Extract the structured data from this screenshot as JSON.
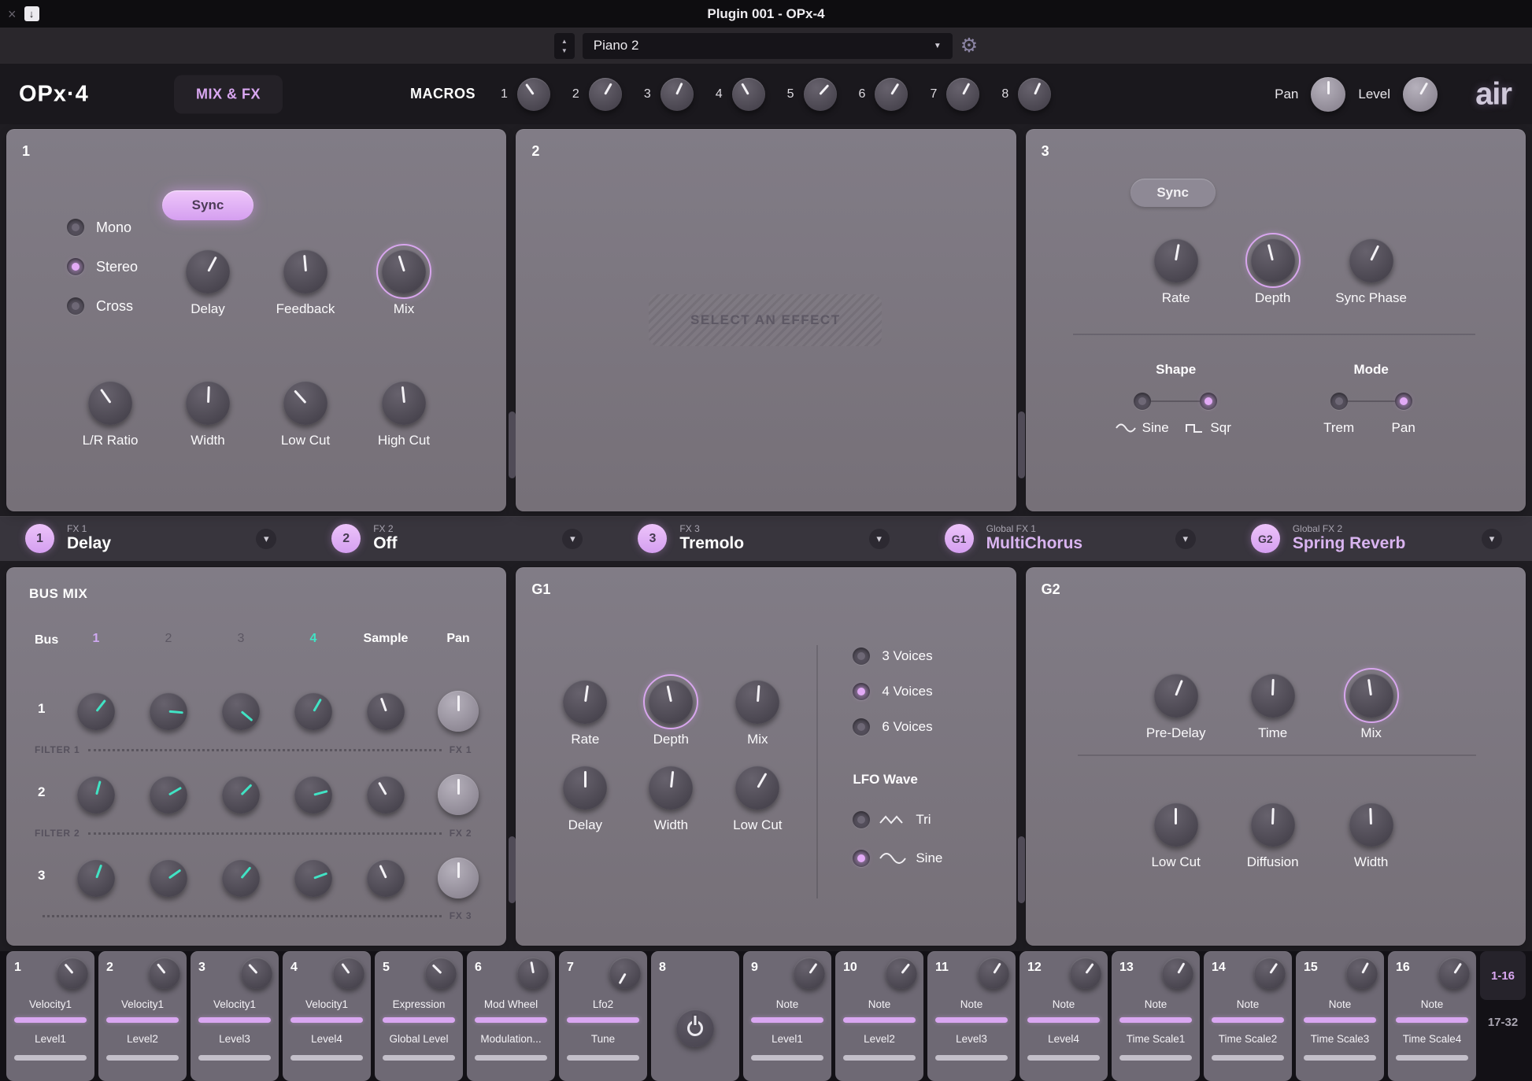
{
  "colors": {
    "accent_purple": "#d9a7f1",
    "accent_teal": "#41e3c4"
  },
  "icons": {
    "close": "×",
    "download": "↓",
    "stepper_up": "▲",
    "stepper_down": "▼",
    "caret_down": "▼",
    "gear": "⚙",
    "chevron_down": "▾"
  },
  "titlebar": {
    "title": "Plugin 001 - OPx-4"
  },
  "presetbar": {
    "preset": "Piano 2"
  },
  "header": {
    "logo": "OPx·4",
    "mixfx_tab": "MIX & FX",
    "macros_label": "MACROS",
    "macro_knobs": [
      "1",
      "2",
      "3",
      "4",
      "5",
      "6",
      "7",
      "8"
    ],
    "pan_label": "Pan",
    "level_label": "Level",
    "brand": "air"
  },
  "fx1": {
    "number": "1",
    "sync_label": "Sync",
    "channel_modes": [
      "Mono",
      "Stereo",
      "Cross"
    ],
    "selected_mode": "Stereo",
    "knobs_top": [
      "Delay",
      "Feedback",
      "Mix"
    ],
    "knobs_bottom": [
      "L/R Ratio",
      "Width",
      "Low Cut",
      "High Cut"
    ]
  },
  "fx2": {
    "number": "2",
    "placeholder": "SELECT AN EFFECT"
  },
  "fx3": {
    "number": "3",
    "sync_label": "Sync",
    "knobs": [
      "Rate",
      "Depth",
      "Sync Phase"
    ],
    "shape": {
      "label": "Shape",
      "options": [
        "Sine",
        "Sqr"
      ],
      "selected": "Sqr"
    },
    "mode": {
      "label": "Mode",
      "options": [
        "Trem",
        "Pan"
      ],
      "selected": "Pan"
    }
  },
  "fx_tabs": [
    {
      "id": "1",
      "sub": "FX 1",
      "name": "Delay"
    },
    {
      "id": "2",
      "sub": "FX 2",
      "name": "Off"
    },
    {
      "id": "3",
      "sub": "FX 3",
      "name": "Tremolo"
    },
    {
      "id": "G1",
      "sub": "Global FX 1",
      "name": "MultiChorus"
    },
    {
      "id": "G2",
      "sub": "Global FX 2",
      "name": "Spring Reverb"
    }
  ],
  "bus_mix": {
    "title": "BUS MIX",
    "bus_label": "Bus",
    "columns": [
      "1",
      "2",
      "3",
      "4",
      "Sample",
      "Pan"
    ],
    "rows": [
      {
        "num": "1",
        "left": "FILTER 1",
        "right": "FX 1"
      },
      {
        "num": "2",
        "left": "FILTER 2",
        "right": "FX 2"
      },
      {
        "num": "3",
        "left": "",
        "right": "FX 3"
      }
    ]
  },
  "g1": {
    "label": "G1",
    "knobs_top": [
      "Rate",
      "Depth",
      "Mix"
    ],
    "knobs_bottom": [
      "Delay",
      "Width",
      "Low Cut"
    ],
    "voices": [
      "3 Voices",
      "4 Voices",
      "6 Voices"
    ],
    "selected_voice": "4 Voices",
    "lfo_label": "LFO Wave",
    "lfo_options": [
      "Tri",
      "Sine"
    ],
    "selected_lfo": "Sine"
  },
  "g2": {
    "label": "G2",
    "knobs_top": [
      "Pre-Delay",
      "Time",
      "Mix"
    ],
    "knobs_bottom": [
      "Low Cut",
      "Diffusion",
      "Width"
    ]
  },
  "macros": {
    "slots": [
      {
        "num": "1",
        "source": "Velocity1",
        "dest": "Level1"
      },
      {
        "num": "2",
        "source": "Velocity1",
        "dest": "Level2"
      },
      {
        "num": "3",
        "source": "Velocity1",
        "dest": "Level3"
      },
      {
        "num": "4",
        "source": "Velocity1",
        "dest": "Level4"
      },
      {
        "num": "5",
        "source": "Expression",
        "dest": "Global Level"
      },
      {
        "num": "6",
        "source": "Mod Wheel",
        "dest": "Modulation..."
      },
      {
        "num": "7",
        "source": "Lfo2",
        "dest": "Tune"
      },
      {
        "num": "8",
        "source": "",
        "dest": ""
      },
      {
        "num": "9",
        "source": "Note",
        "dest": "Level1"
      },
      {
        "num": "10",
        "source": "Note",
        "dest": "Level2"
      },
      {
        "num": "11",
        "source": "Note",
        "dest": "Level3"
      },
      {
        "num": "12",
        "source": "Note",
        "dest": "Level4"
      },
      {
        "num": "13",
        "source": "Note",
        "dest": "Time Scale1"
      },
      {
        "num": "14",
        "source": "Note",
        "dest": "Time Scale2"
      },
      {
        "num": "15",
        "source": "Note",
        "dest": "Time Scale3"
      },
      {
        "num": "16",
        "source": "Note",
        "dest": "Time Scale4"
      }
    ],
    "pages": [
      "1-16",
      "17-32"
    ],
    "active_page": "1-16"
  }
}
